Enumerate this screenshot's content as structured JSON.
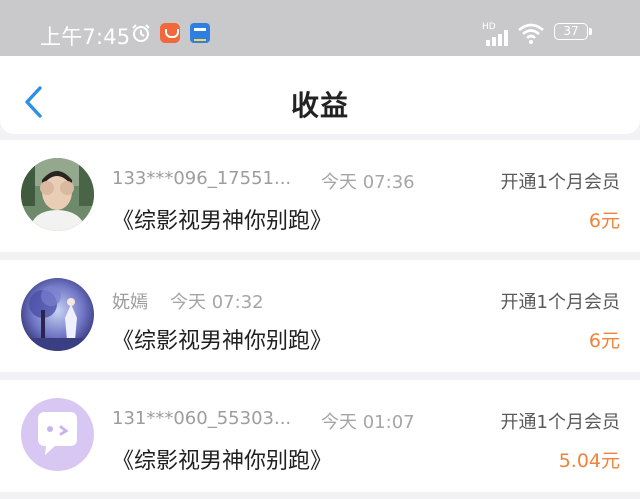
{
  "status_bar": {
    "time": "上午7:45",
    "hd_label": "HD",
    "battery_level": "37"
  },
  "header": {
    "title": "收益"
  },
  "records": [
    {
      "user": "133***096_17551...",
      "time": "今天 07:36",
      "book": "《综影视男神你别跑》",
      "description": "开通1个月会员",
      "amount": "6元"
    },
    {
      "user": "妩嫣",
      "time": "今天 07:32",
      "book": "《综影视男神你别跑》",
      "description": "开通1个月会员",
      "amount": "6元"
    },
    {
      "user": "131***060_55303...",
      "time": "今天 01:07",
      "book": "《综影视男神你别跑》",
      "description": "开通1个月会员",
      "amount": "5.04元"
    }
  ],
  "colors": {
    "amount": "#f1823a",
    "back_arrow": "#2f8fe6",
    "status_bar": "#c9c9cb"
  },
  "icons": [
    "alarm-icon",
    "app-icon",
    "app-icon",
    "signal-icon",
    "wifi-icon",
    "battery-icon",
    "back-arrow-icon",
    "chat-bubble-icon"
  ]
}
